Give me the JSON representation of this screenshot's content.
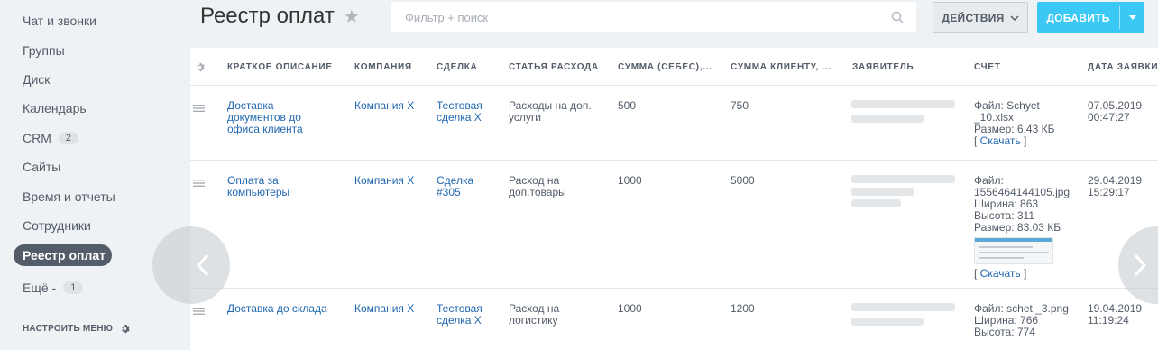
{
  "sidebar": {
    "items": [
      {
        "label": "Чат и звонки"
      },
      {
        "label": "Группы"
      },
      {
        "label": "Диск"
      },
      {
        "label": "Календарь"
      },
      {
        "label": "CRM",
        "badge": "2"
      },
      {
        "label": "Сайты"
      },
      {
        "label": "Время и отчеты"
      },
      {
        "label": "Сотрудники"
      },
      {
        "label": "Реестр оплат",
        "active": true
      },
      {
        "label": "Ещё -",
        "badge": "1"
      }
    ],
    "settings_label": "НАСТРОИТЬ МЕНЮ",
    "settings_icon": "gear-icon"
  },
  "header": {
    "title": "Реестр оплат",
    "favorite_icon": "star-icon",
    "search_placeholder": "Фильтр + поиск",
    "actions_label": "ДЕЙСТВИЯ",
    "add_label": "ДОБАВИТЬ"
  },
  "grid": {
    "columns": [
      "КРАТКОЕ ОПИСАНИЕ",
      "КОМПАНИЯ",
      "СДЕЛКА",
      "СТАТЬЯ РАСХОДА",
      "СУММА (СЕБЕС),...",
      "СУММА КЛИЕНТУ, ...",
      "ЗАЯВИТЕЛЬ",
      "СЧЕТ",
      "ДАТА ЗАЯВКИ"
    ],
    "rows": [
      {
        "description": "Доставка документов до офиса клиента",
        "company": "Компания Х",
        "deal": "Тестовая сделка Х",
        "expense": "Расходы на доп. услуги",
        "cost": "500",
        "client_sum": "750",
        "invoice": {
          "file": "Файл: Schyet _10.xlsx",
          "size": "Размер: 6.43 КБ",
          "download": "Скачать"
        },
        "date": "07.05.2019",
        "time": "00:47:27"
      },
      {
        "description": "Оплата за компьютеры",
        "company": "Компания Х",
        "deal": "Сделка #305",
        "expense": "Расход на доп.товары",
        "cost": "1000",
        "client_sum": "5000",
        "invoice": {
          "file": "Файл: 1556464144105.jpg",
          "width": "Ширина: 863",
          "height": "Высота: 311",
          "size": "Размер: 83.03 КБ",
          "download": "Скачать"
        },
        "date": "29.04.2019",
        "time": "15:29:17"
      },
      {
        "description": "Доставка до склада",
        "company": "Компания Х",
        "deal": "Тестовая сделка Х",
        "expense": "Расход на логистику",
        "cost": "1000",
        "client_sum": "1200",
        "invoice": {
          "file": "Файл: schet _3.png",
          "width": "Ширина: 766",
          "height": "Высота: 774"
        },
        "date": "19.04.2019",
        "time": "11:19:24"
      }
    ]
  },
  "colors": {
    "accent": "#3bc8f5",
    "link": "#2067b0",
    "active_nav": "#535c69"
  }
}
